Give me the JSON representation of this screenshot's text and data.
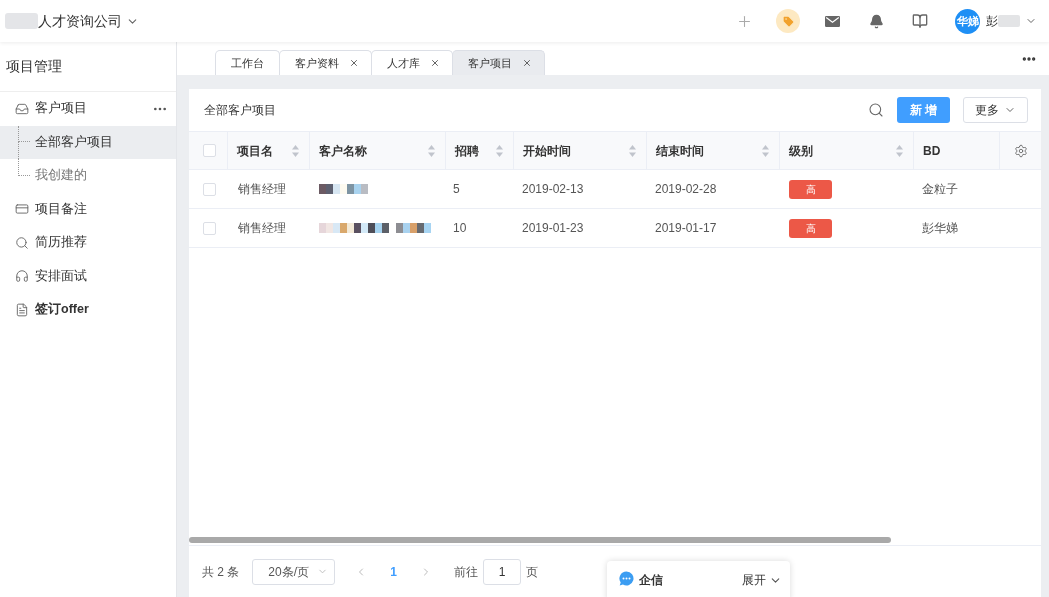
{
  "header": {
    "company": "人才资询公司",
    "avatar": "华娣",
    "user_name": "彭"
  },
  "sidebar": {
    "title": "项目管理",
    "items": [
      {
        "label": "客户项目",
        "selected": false,
        "children": [
          {
            "label": "全部客户项目",
            "selected": true
          },
          {
            "label": "我创建的",
            "selected": false
          }
        ]
      },
      {
        "label": "项目备注",
        "selected": false
      },
      {
        "label": "简历推荐",
        "selected": false
      },
      {
        "label": "安排面试",
        "selected": false
      },
      {
        "label": "签订offer",
        "selected": false
      }
    ]
  },
  "tabs": [
    {
      "label": "工作台",
      "closable": false,
      "selected": false
    },
    {
      "label": "客户资料",
      "closable": true,
      "selected": false
    },
    {
      "label": "人才库",
      "closable": true,
      "selected": false
    },
    {
      "label": "客户项目",
      "closable": true,
      "selected": true
    }
  ],
  "content": {
    "title": "全部客户项目",
    "buttons": [
      {
        "label": "新增",
        "kind": "primary"
      },
      {
        "label": "更多",
        "kind": "dropdown"
      }
    ]
  },
  "table": {
    "all_checked": false,
    "columns": [
      {
        "label": "项目名",
        "sortable": true
      },
      {
        "label": "客户名称",
        "sortable": true
      },
      {
        "label": "招聘",
        "sortable": true
      },
      {
        "label": "开始时间",
        "sortable": true
      },
      {
        "label": "结束时间",
        "sortable": true
      },
      {
        "label": "级别",
        "sortable": true
      },
      {
        "label": "BD",
        "sortable": false
      }
    ],
    "rows": [
      {
        "checked": false,
        "project": "销售经理",
        "recruits": "5",
        "start": "2019-02-13",
        "end": "2019-02-28",
        "grade": "高",
        "bd": "金粒子"
      },
      {
        "checked": false,
        "project": "销售经理",
        "recruits": "10",
        "start": "2019-01-23",
        "end": "2019-01-17",
        "grade": "高",
        "bd": "彭华娣"
      }
    ]
  },
  "pagination": {
    "total": "共 2 条",
    "page_size": "20条/页",
    "pages": [
      {
        "label": "1",
        "selected": true
      }
    ],
    "goto_label": "前往",
    "goto_value": "1",
    "goto_suffix": "页"
  },
  "chat": {
    "label": "企信",
    "action": "展开"
  }
}
